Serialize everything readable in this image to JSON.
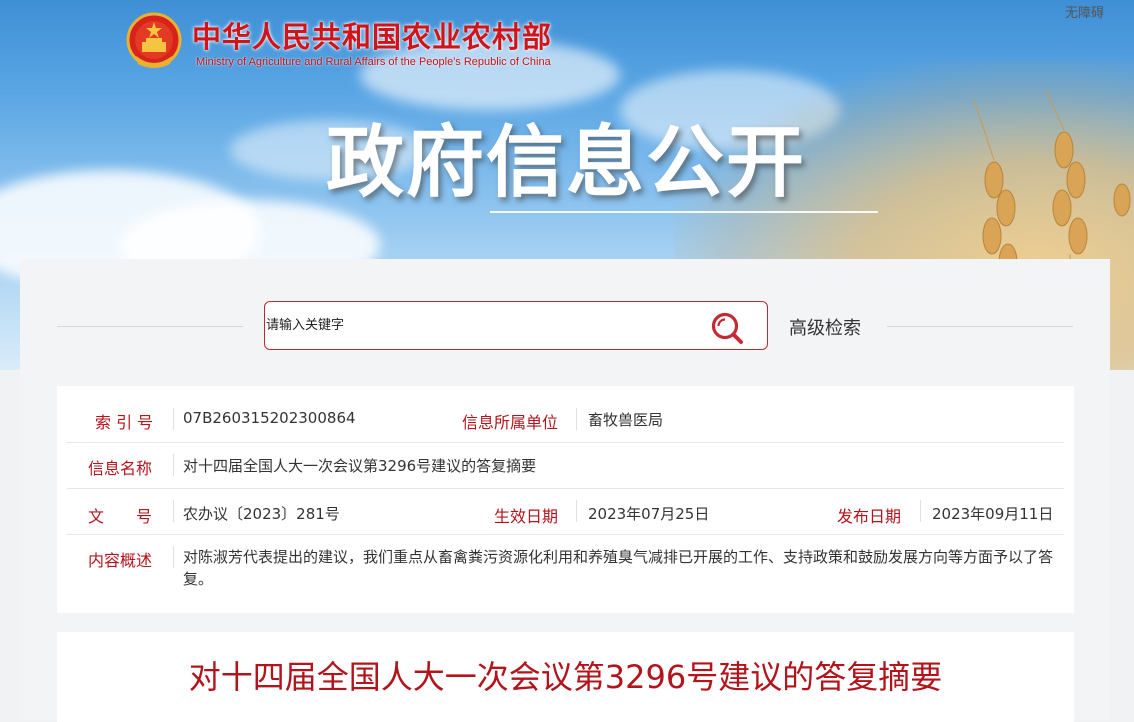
{
  "header": {
    "ministry_cn": "中华人民共和国农业农村部",
    "ministry_en": "Ministry of Agriculture and Rural Affairs of the People's Republic of China",
    "accessibility": "无障碍",
    "banner_title": "政府信息公开"
  },
  "search": {
    "placeholder": "请输入关键字",
    "advanced_label": "高级检索"
  },
  "info": {
    "index_label": "索 引 号",
    "index_value": "07B260315202300864",
    "unit_label": "信息所属单位",
    "unit_value": "畜牧兽医局",
    "name_label": "信息名称",
    "name_value": "对十四届全国人大一次会议第3296号建议的答复摘要",
    "doc_label": "文　　号",
    "doc_value": "农办议〔2023〕281号",
    "effective_label": "生效日期",
    "effective_value": "2023年07月25日",
    "publish_label": "发布日期",
    "publish_value": "2023年09月11日",
    "summary_label": "内容概述",
    "summary_value": "对陈淑芳代表提出的建议，我们重点从畜禽粪污资源化利用和养殖臭气减排已开展的工作、支持政策和鼓励发展方向等方面予以了答复。"
  },
  "article": {
    "title": "对十四届全国人大一次会议第3296号建议的答复摘要"
  },
  "colors": {
    "brand_red": "#b3141b",
    "sky": "#5aa6e4",
    "wheat": "#e4be7d"
  }
}
